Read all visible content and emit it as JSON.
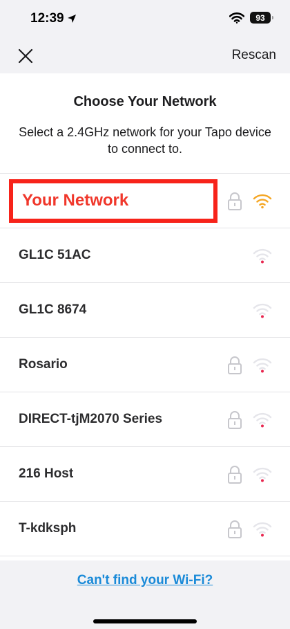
{
  "status_bar": {
    "time": "12:39",
    "location_icon": "location-arrow-icon",
    "wifi_icon": "wifi-icon",
    "battery": "93"
  },
  "nav": {
    "close_icon": "close-icon",
    "rescan_label": "Rescan"
  },
  "header": {
    "title": "Choose Your Network",
    "subtitle": "Select a 2.4GHz network for your Tapo device to connect to."
  },
  "networks": [
    {
      "name": "Your Network",
      "locked": true,
      "signal": "weak",
      "signal_color": "#f5a623",
      "highlighted": true
    },
    {
      "name": "GL1C 51AC",
      "locked": false,
      "signal": "weak",
      "signal_color": "#e8264f",
      "highlighted": false
    },
    {
      "name": "GL1C 8674",
      "locked": false,
      "signal": "weak",
      "signal_color": "#e8264f",
      "highlighted": false
    },
    {
      "name": "Rosario",
      "locked": true,
      "signal": "weak",
      "signal_color": "#e8264f",
      "highlighted": false
    },
    {
      "name": "DIRECT-tjM2070 Series",
      "locked": true,
      "signal": "weak",
      "signal_color": "#e8264f",
      "highlighted": false
    },
    {
      "name": "216 Host",
      "locked": true,
      "signal": "weak",
      "signal_color": "#e8264f",
      "highlighted": false
    },
    {
      "name": "T-kdksph",
      "locked": true,
      "signal": "weak",
      "signal_color": "#e8264f",
      "highlighted": false
    }
  ],
  "footer": {
    "help_link": "Can't find your Wi-Fi?"
  },
  "colors": {
    "accent_link": "#1a8ad8",
    "highlight_red": "#f7231a"
  }
}
